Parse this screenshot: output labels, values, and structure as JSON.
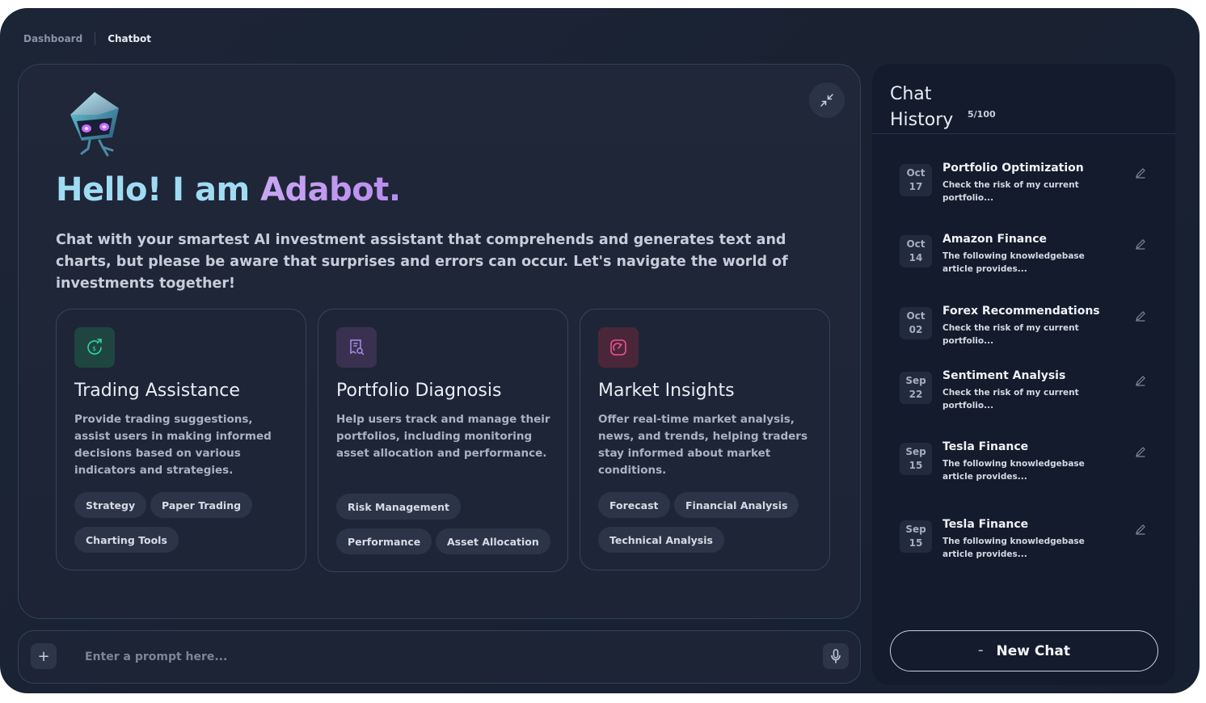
{
  "breadcrumb": [
    "Dashboard",
    "Chatbot"
  ],
  "hero": {
    "greeting": "Hello! I am ",
    "bot_name": "Adabot.",
    "intro": "Chat with your smartest AI investment assistant that comprehends and generates text and charts, but please be aware that surprises and errors can occur. Let's navigate the world of investments together!"
  },
  "features": [
    {
      "icon": "dollar-refresh-icon",
      "title": "Trading Assistance",
      "description": "Provide trading suggestions, assist users in making informed decisions based on various indicators and strategies.",
      "tags": [
        "Strategy",
        "Paper Trading",
        "Charting Tools"
      ]
    },
    {
      "icon": "receipt-search-icon",
      "title": "Portfolio Diagnosis",
      "description": "Help users track and manage their portfolios, including monitoring asset allocation and performance.",
      "tags": [
        "Risk Management",
        "Performance",
        "Asset Allocation"
      ]
    },
    {
      "icon": "gauge-icon",
      "title": "Market Insights",
      "description": "Offer real-time market analysis, news, and trends, helping traders stay informed about market conditions.",
      "tags": [
        "Forecast",
        "Financial Analysis",
        "Technical Analysis"
      ]
    }
  ],
  "prompt": {
    "placeholder": "Enter a prompt here..."
  },
  "history": {
    "title_line1": "Chat",
    "title_line2": "History",
    "count": "5/100",
    "items": [
      {
        "month": "Oct",
        "day": "17",
        "title": "Portfolio Optimization",
        "snippet": "Check the risk of my current portfolio..."
      },
      {
        "month": "Oct",
        "day": "14",
        "title": "Amazon Finance",
        "snippet": "The following knowledgebase article provides..."
      },
      {
        "month": "Oct",
        "day": "02",
        "title": "Forex Recommendations",
        "snippet": "Check the risk of my current portfolio..."
      },
      {
        "month": "Sep",
        "day": "22",
        "title": "Sentiment Analysis",
        "snippet": "Check the risk of my current portfolio..."
      },
      {
        "month": "Sep",
        "day": "15",
        "title": "Tesla Finance",
        "snippet": "The following knowledgebase article provides..."
      },
      {
        "month": "Sep",
        "day": "15",
        "title": "Tesla Finance",
        "snippet": "The following knowledgebase article provides..."
      }
    ],
    "new_chat_label": "New Chat"
  },
  "colors": {
    "accent_cyan": "#9fdcf3",
    "accent_purple": "#c9a7f2",
    "trading_icon": "#2fd1a8",
    "portfolio_icon": "#a98be8",
    "market_icon": "#f0508f"
  }
}
